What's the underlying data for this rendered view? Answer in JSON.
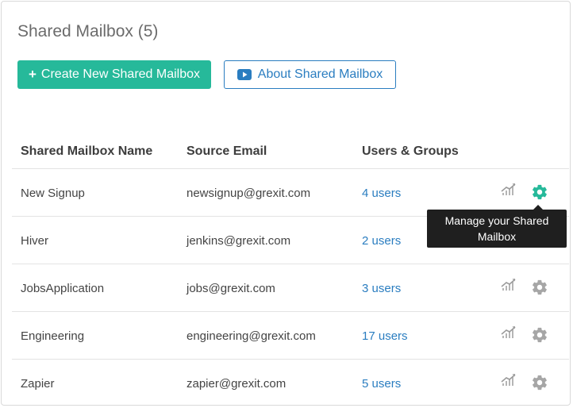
{
  "header": {
    "title": "Shared Mailbox (5)",
    "create_button": "Create New Shared Mailbox",
    "about_button": "About Shared Mailbox"
  },
  "table": {
    "columns": [
      "Shared Mailbox Name",
      "Source Email",
      "Users & Groups"
    ],
    "rows": [
      {
        "name": "New Signup",
        "email": "newsignup@grexit.com",
        "users": "4 users"
      },
      {
        "name": "Hiver",
        "email": "jenkins@grexit.com",
        "users": "2 users"
      },
      {
        "name": "JobsApplication",
        "email": "jobs@grexit.com",
        "users": "3 users"
      },
      {
        "name": "Engineering",
        "email": "engineering@grexit.com",
        "users": "17 users"
      },
      {
        "name": "Zapier",
        "email": "zapier@grexit.com",
        "users": "5 users"
      }
    ]
  },
  "tooltip": {
    "text": "Manage your Shared Mailbox"
  },
  "icons": {
    "create": "plus-icon",
    "about": "video-play-icon",
    "stats": "analytics-icon",
    "settings": "gear-icon"
  },
  "colors": {
    "primary_green": "#26b99a",
    "link_blue": "#2a7dc0",
    "icon_gray": "#9b9b9b"
  }
}
